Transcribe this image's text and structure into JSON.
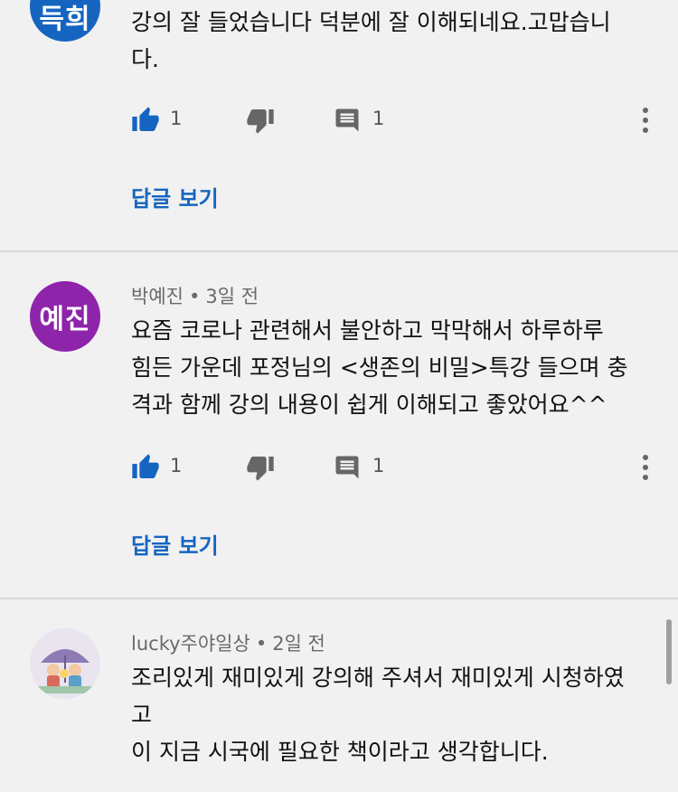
{
  "comments": [
    {
      "avatar_text": "득희",
      "avatar_color": "#1565c0",
      "lines": [
        "강의 잘 들었습니다 덕분에 잘 이해되네요.고맙습니",
        "다."
      ],
      "likes": "1",
      "replies_count": "1",
      "view_replies": "답글 보기"
    },
    {
      "author": "박예진",
      "time": "3일 전",
      "avatar_text": "예진",
      "avatar_color": "#8e24aa",
      "lines": [
        "요즘 코로나 관련해서 불안하고 막막해서 하루하루",
        "힘든 가운데 포정님의 <생존의 비밀>특강 들으며 충",
        "격과 함께 강의 내용이 쉽게 이해되고 좋았어요^^"
      ],
      "likes": "1",
      "replies_count": "1",
      "view_replies": "답글 보기"
    },
    {
      "author": "lucky주야일상",
      "time": "2일 전",
      "lines": [
        "조리있게 재미있게 강의해 주셔서 재미있게 시청하였",
        "고",
        "이 지금 시국에 필요한 책이라고 생각합니다."
      ]
    }
  ],
  "separator": "•",
  "icons": {
    "like": "thumbs-up-icon",
    "dislike": "thumbs-down-icon",
    "reply": "reply-comment-icon",
    "more": "more-vertical-icon"
  },
  "colors": {
    "link": "#1565c0",
    "background": "#f1f1f1"
  }
}
